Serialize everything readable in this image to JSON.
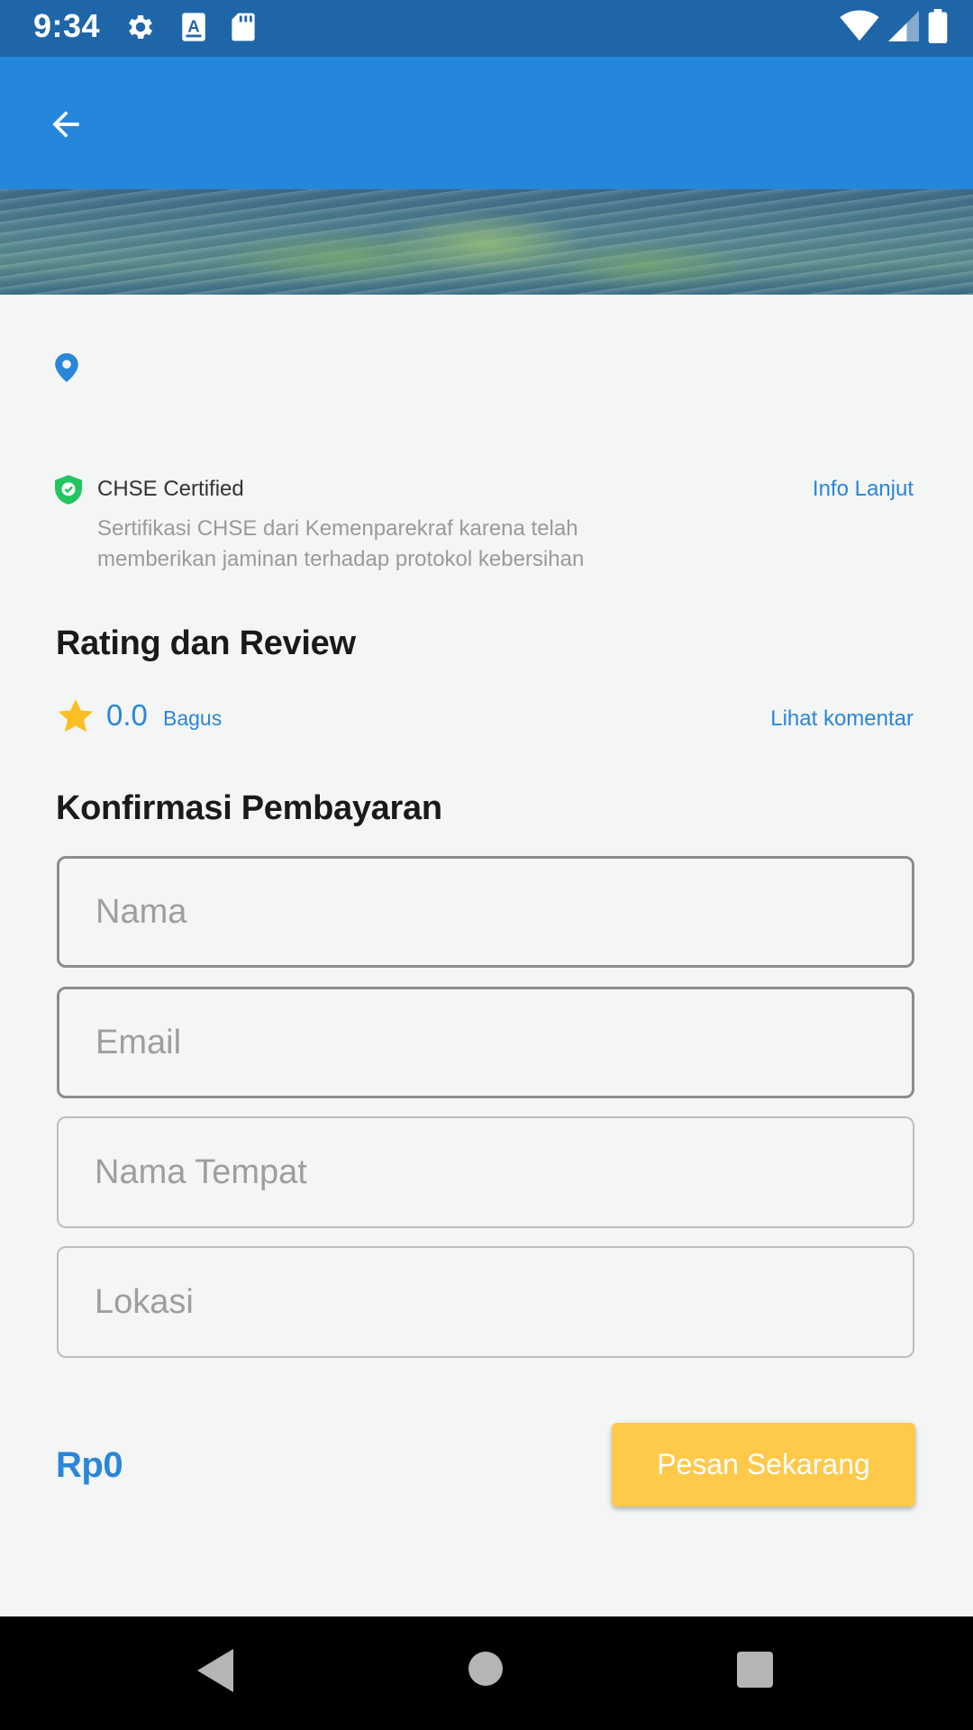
{
  "status_bar": {
    "time": "9:34",
    "icons_left": [
      "gear-icon",
      "a-box-icon",
      "sd-card-icon"
    ],
    "icons_right": [
      "wifi-icon",
      "signal-icon",
      "battery-icon"
    ]
  },
  "app_bar": {
    "back_icon": "arrow-left-icon"
  },
  "location": {
    "icon": "location-pin-icon",
    "text": ""
  },
  "chse": {
    "icon": "shield-check-icon",
    "title": "CHSE Certified",
    "description": "Sertifikasi CHSE dari Kemenparekraf karena telah memberikan jaminan terhadap protokol kebersihan",
    "info_link": "Info Lanjut"
  },
  "rating": {
    "section_title": "Rating dan Review",
    "value": "0.0",
    "label": "Bagus",
    "comments_link": "Lihat komentar"
  },
  "payment": {
    "section_title": "Konfirmasi Pembayaran",
    "fields": [
      {
        "placeholder": "Nama",
        "value": ""
      },
      {
        "placeholder": "Email",
        "value": ""
      },
      {
        "placeholder": "Nama Tempat",
        "value": ""
      },
      {
        "placeholder": "Lokasi",
        "value": ""
      }
    ],
    "price": "Rp0",
    "order_button": "Pesan Sekarang"
  },
  "colors": {
    "status_bar": "#1f66a8",
    "app_bar": "#2487dc",
    "accent": "#2a86d8",
    "button": "#ffc94a",
    "star": "#fbbf24",
    "shield": "#22c55e"
  }
}
